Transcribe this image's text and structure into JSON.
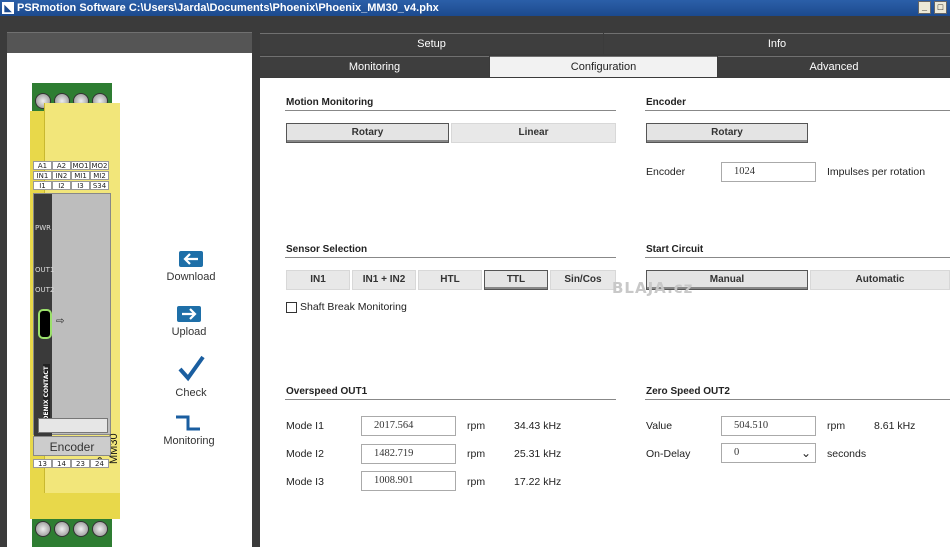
{
  "window": {
    "title": "PSRmotion Software  C:\\Users\\Jarda\\Documents\\Phoenix\\Phoenix_MM30_v4.phx",
    "minimize": "_",
    "maximize": "□"
  },
  "device": {
    "name": "PSR-MM30",
    "terminals_top": [
      "A1",
      "A2",
      "MO1",
      "MO2",
      "IN1",
      "IN2",
      "MI1",
      "MI2",
      "I1",
      "I2",
      "I3",
      "S34"
    ],
    "terminals_bottom": [
      "13",
      "14",
      "23",
      "24"
    ],
    "led_pwr": "PWR",
    "led_out1": "OUT1",
    "led_out2": "OUT2",
    "module_label": "Encoder",
    "brand_logo": "PHOENIX CONTACT"
  },
  "actions": [
    {
      "label": "Download",
      "icon": "download-icon"
    },
    {
      "label": "Upload",
      "icon": "upload-icon"
    },
    {
      "label": "Check",
      "icon": "check-icon"
    },
    {
      "label": "Monitoring",
      "icon": "monitoring-icon"
    }
  ],
  "tabs_top": [
    {
      "label": "Setup"
    },
    {
      "label": "Info"
    }
  ],
  "tabs_sub": [
    {
      "label": "Monitoring",
      "active": false
    },
    {
      "label": "Configuration",
      "active": true
    },
    {
      "label": "Advanced",
      "active": false
    }
  ],
  "motion": {
    "title": "Motion Monitoring",
    "options": [
      "Rotary",
      "Linear"
    ],
    "selected": "Rotary"
  },
  "encoder": {
    "title": "Encoder",
    "options": [
      "Rotary"
    ],
    "label": "Encoder",
    "value": "1024",
    "unit": "Impulses per rotation"
  },
  "sensor": {
    "title": "Sensor Selection",
    "options": [
      "IN1",
      "IN1 + IN2",
      "HTL",
      "TTL",
      "Sin/Cos"
    ],
    "selected": "TTL",
    "checkbox_label": "Shaft Break Monitoring",
    "checkbox_checked": false
  },
  "start": {
    "title": "Start Circuit",
    "options": [
      "Manual",
      "Automatic"
    ],
    "selected": "Manual"
  },
  "overspeed": {
    "title": "Overspeed  OUT1",
    "rows": [
      {
        "label": "Mode I1",
        "value": "2017.564",
        "unit": "rpm",
        "freq": "34.43 kHz"
      },
      {
        "label": "Mode I2",
        "value": "1482.719",
        "unit": "rpm",
        "freq": "25.31 kHz"
      },
      {
        "label": "Mode I3",
        "value": "1008.901",
        "unit": "rpm",
        "freq": "17.22 kHz"
      }
    ]
  },
  "zerospeed": {
    "title": "Zero Speed  OUT2",
    "value_label": "Value",
    "value": "504.510",
    "value_unit": "rpm",
    "value_freq": "8.61 kHz",
    "delay_label": "On-Delay",
    "delay_value": "0",
    "delay_unit": "seconds"
  },
  "watermark": "BLAJA.cz",
  "colors": {
    "titlebar": "#1c4a8e",
    "dark": "#3b3b3b",
    "device_yellow": "#e8d84a",
    "terminal_green": "#2e7d32",
    "accent_blue": "#1e6fa8",
    "check_blue": "#1a5ea0"
  }
}
